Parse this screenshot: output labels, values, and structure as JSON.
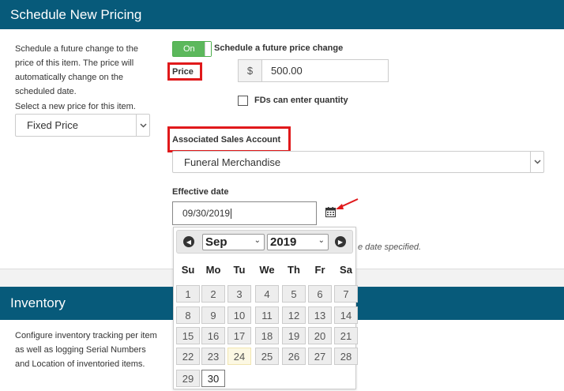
{
  "schedule": {
    "header": "Schedule New Pricing",
    "description": "Schedule a future change to the price of this item. The price will automatically change on the scheduled date.",
    "select_label": "Select a new price for this item.",
    "price_type": "Fixed Price",
    "toggle_label": "On",
    "toggle_text": "Schedule a future price change",
    "price_label": "Price",
    "currency": "$",
    "price_value": "500.00",
    "checkbox_label": "FDs can enter quantity",
    "account_label": "Associated Sales Account",
    "account_value": "Funeral Merchandise",
    "effective_label": "Effective date",
    "effective_value": "09/30/2019",
    "hint_text": "e date specified."
  },
  "datepicker": {
    "month": "Sep",
    "year": "2019",
    "weekdays": [
      "Su",
      "Mo",
      "Tu",
      "We",
      "Th",
      "Fr",
      "Sa"
    ],
    "weeks": [
      [
        "1",
        "2",
        "3",
        "4",
        "5",
        "6",
        "7"
      ],
      [
        "8",
        "9",
        "10",
        "11",
        "12",
        "13",
        "14"
      ],
      [
        "15",
        "16",
        "17",
        "18",
        "19",
        "20",
        "21"
      ],
      [
        "22",
        "23",
        "24",
        "25",
        "26",
        "27",
        "28"
      ],
      [
        "29",
        "30"
      ]
    ],
    "today": "24",
    "selected": "30"
  },
  "inventory": {
    "header": "Inventory",
    "description": "Configure inventory tracking per item as well as logging Serial Numbers and Location of inventoried items."
  },
  "colors": {
    "header_bg": "#075a7a",
    "toggle_green": "#5cb85c",
    "highlight_red": "#e0191b"
  }
}
